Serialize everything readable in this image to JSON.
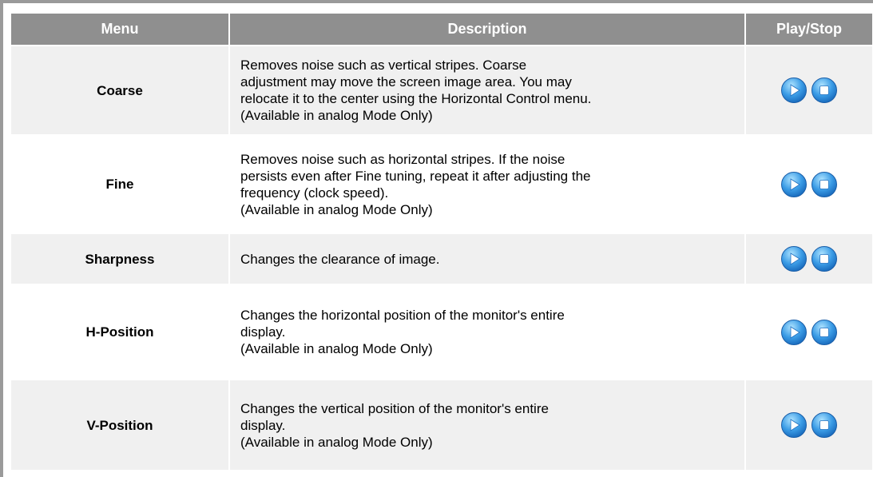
{
  "table": {
    "headers": {
      "menu": "Menu",
      "description": "Description",
      "play_stop": "Play/Stop"
    },
    "rows": [
      {
        "menu": "Coarse",
        "desc_lines": [
          "Removes noise such as vertical stripes. Coarse",
          "adjustment may move the screen image area. You may",
          "relocate it to the center using the Horizontal Control menu.",
          "(Available in analog Mode Only)"
        ]
      },
      {
        "menu": "Fine",
        "desc_lines": [
          "Removes noise such as horizontal stripes. If the noise",
          "persists even after Fine tuning, repeat it after adjusting the",
          "frequency (clock speed).",
          "(Available in analog Mode Only)"
        ]
      },
      {
        "menu": "Sharpness",
        "desc_lines": [
          "Changes the clearance of image."
        ]
      },
      {
        "menu": "H-Position",
        "desc_lines": [
          "Changes the horizontal position of the monitor's entire",
          "display.",
          "(Available in analog Mode Only)"
        ]
      },
      {
        "menu": "V-Position",
        "desc_lines": [
          "Changes the vertical position of the monitor's entire",
          "display.",
          "(Available in analog Mode Only)"
        ]
      }
    ]
  },
  "icons": {
    "play": "play-icon",
    "stop": "stop-icon"
  },
  "colors": {
    "header_bg": "#8f8f8f",
    "row_alt_bg": "#f0f0f0",
    "button_blue": "#2f8fd8"
  }
}
